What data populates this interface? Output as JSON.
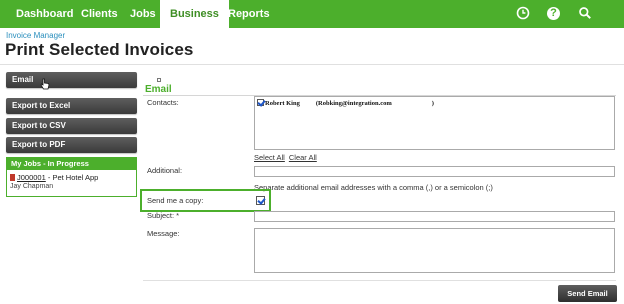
{
  "nav": {
    "tabs": [
      {
        "label": "Dashboard"
      },
      {
        "label": "Clients"
      },
      {
        "label": "Jobs"
      },
      {
        "label": "Business"
      },
      {
        "label": "Reports"
      }
    ],
    "active_tab": "Business",
    "icons": [
      "clock-icon",
      "help-icon",
      "search-icon"
    ],
    "help_glyph": "?"
  },
  "header": {
    "breadcrumb": "Invoice Manager",
    "title": "Print Selected Invoices"
  },
  "sidebar": {
    "buttons": [
      {
        "label": "Email"
      },
      {
        "label": "Export to Excel"
      },
      {
        "label": "Export to CSV"
      },
      {
        "label": "Export to PDF"
      }
    ],
    "jobs_panel": {
      "title": "My Jobs - In Progress",
      "job_id": "J000001",
      "job_name": " - Pet Hotel App",
      "client": "Jay Chapman"
    }
  },
  "form": {
    "section_title": "Email",
    "contacts_label": "Contacts:",
    "contact": {
      "name": "Robert King",
      "email": "(Robking@integration.com",
      "close": ")",
      "checked": true
    },
    "select_all": "Select All",
    "clear_all": "Clear All",
    "additional_label": "Additional:",
    "additional_value": "",
    "additional_hint": "Separate additional email addresses with a comma (,) or a semicolon (;)",
    "send_copy_label": "Send me a copy:",
    "send_copy_checked": true,
    "subject_label": "Subject: *",
    "subject_value": "",
    "message_label": "Message:",
    "message_value": "",
    "send_button": "Send Email"
  },
  "colors": {
    "brand_green": "#4caf2c",
    "button_dark": "#3a3a3a",
    "link_blue": "#2a8fbd"
  }
}
